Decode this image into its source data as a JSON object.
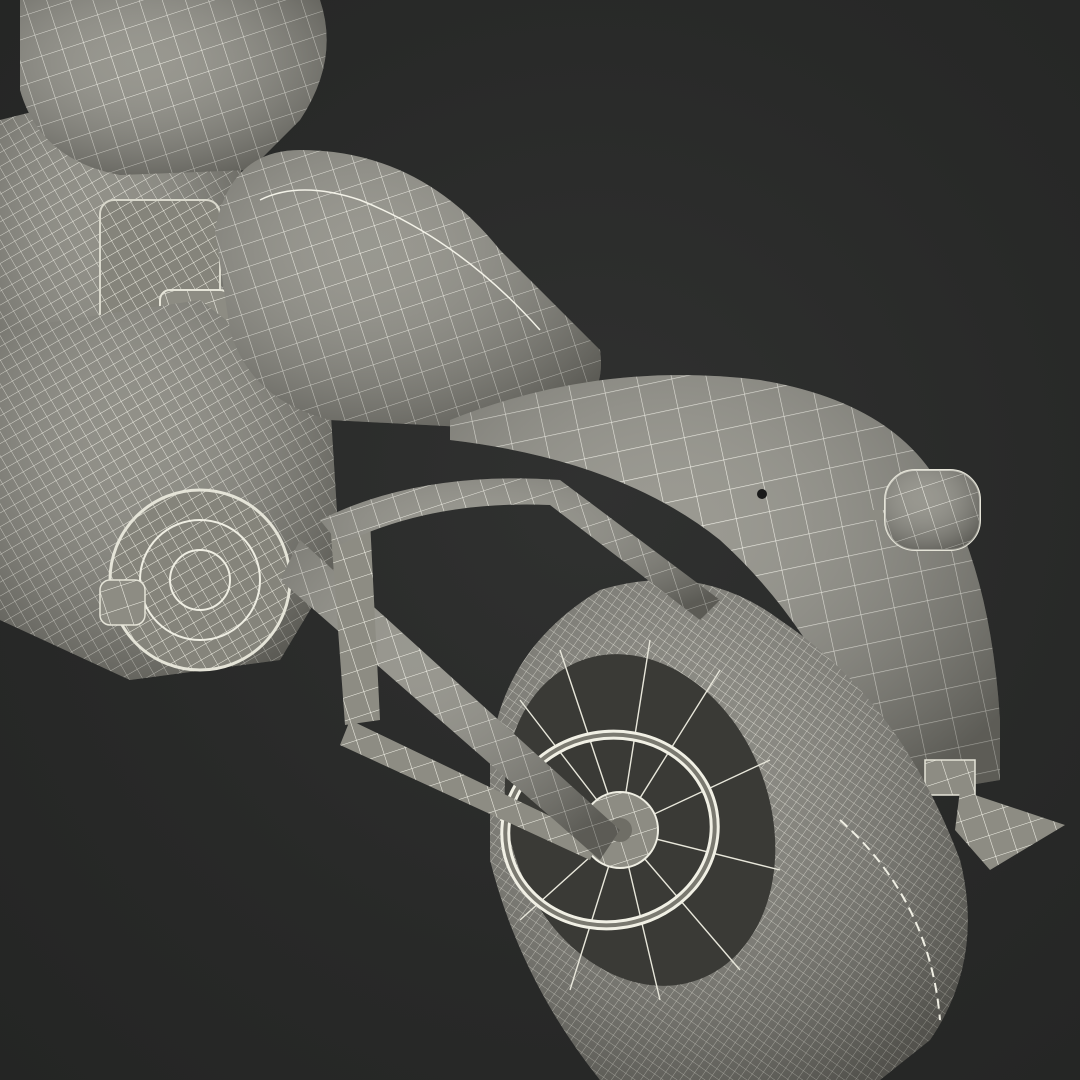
{
  "scene": {
    "subject": "motorcycle-rear-wireframe-render",
    "background_color": "#2a2b2a",
    "surface_color": "#8c8b82",
    "wire_color": "#f2f1e6",
    "shadow_color": "#55554e"
  }
}
